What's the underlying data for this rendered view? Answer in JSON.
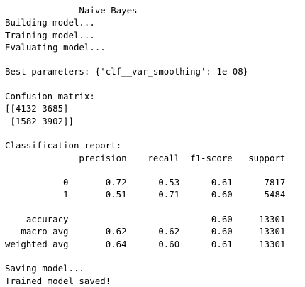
{
  "console": {
    "lines": [
      "------------- Naive Bayes -------------",
      "Building model...",
      "Training model...",
      "Evaluating model...",
      "",
      "Best parameters: {'clf__var_smoothing': 1e-08}",
      "",
      "Confusion matrix:",
      "[[4132 3685]",
      " [1582 3902]]",
      "",
      "Classification report:",
      "              precision    recall  f1-score   support",
      "",
      "           0       0.72      0.53      0.61      7817",
      "           1       0.51      0.71      0.60      5484",
      "",
      "    accuracy                           0.60     13301",
      "   macro avg       0.62      0.62      0.60     13301",
      "weighted avg       0.64      0.60      0.61     13301",
      "",
      "Saving model...",
      "Trained model saved!"
    ]
  }
}
